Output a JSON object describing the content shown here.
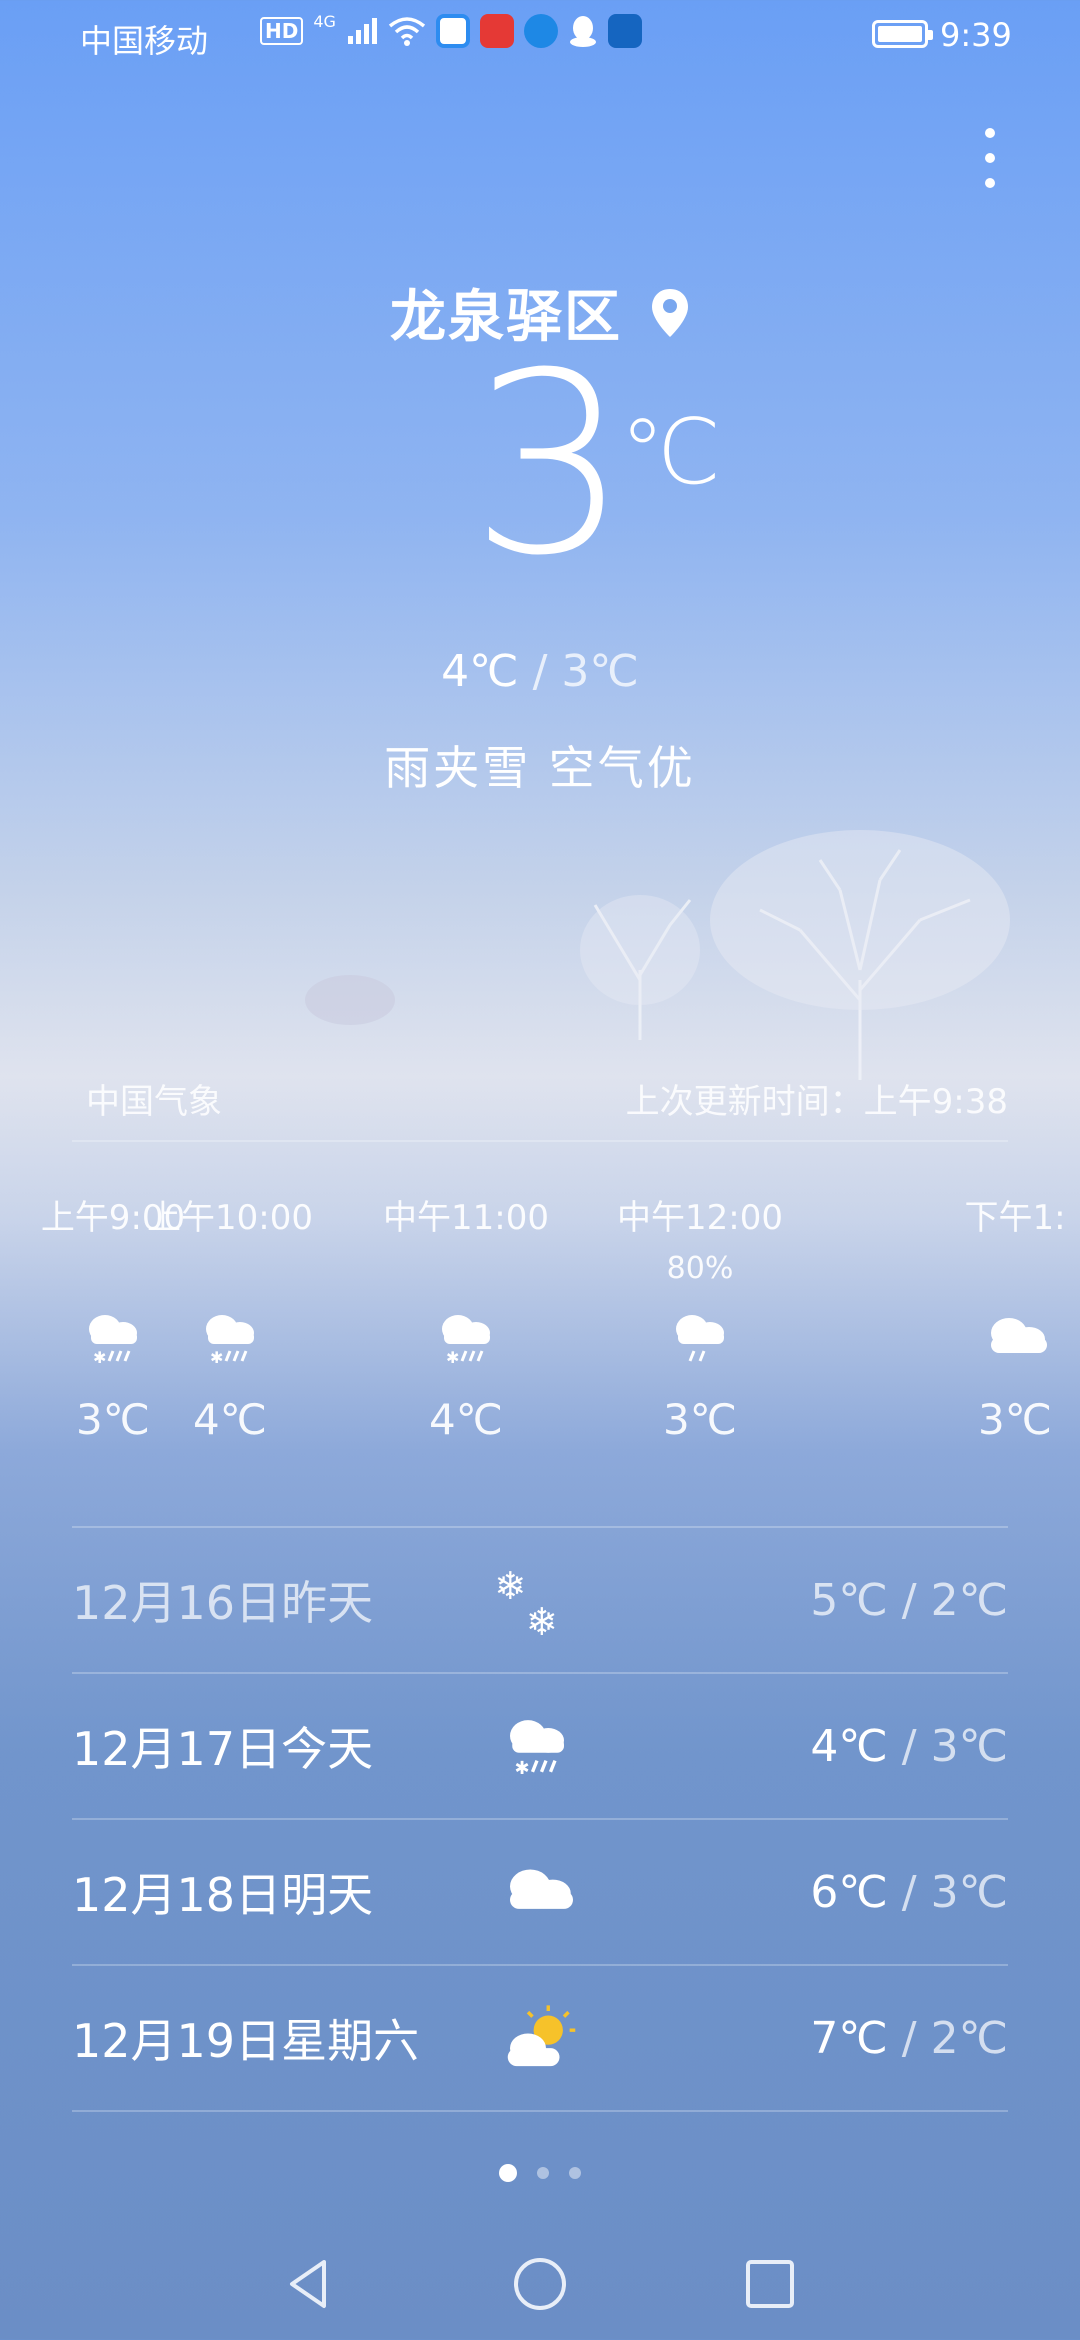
{
  "status_bar": {
    "carrier": "中国移动",
    "hd": "HD",
    "network": "4G",
    "time": "9:39",
    "battery_level": 1.0,
    "app_badge_colors": [
      "#2d8cf0",
      "#e53935",
      "#1e88e5",
      "#ffffff",
      "#1565c0"
    ]
  },
  "header": {
    "city": "龙泉驿区",
    "temperature": "3",
    "unit": "℃",
    "high": "4℃",
    "separator": " / ",
    "low": "3℃",
    "condition": "雨夹雪  空气优"
  },
  "meta": {
    "source": "中国气象",
    "updated": "上次更新时间：上午9:38"
  },
  "hourly": [
    {
      "time": "上午9:00",
      "pop": "",
      "temp": "3℃",
      "icon": "sleet-icon"
    },
    {
      "time": "上午10:00",
      "pop": "",
      "temp": "4℃",
      "icon": "sleet-icon"
    },
    {
      "time": "中午11:00",
      "pop": "",
      "temp": "4℃",
      "icon": "sleet-icon"
    },
    {
      "time": "中午12:00",
      "pop": "80%",
      "temp": "3℃",
      "icon": "rain-icon"
    },
    {
      "time": "下午1:",
      "pop": "",
      "temp": "3℃",
      "icon": "cloud-icon"
    }
  ],
  "daily": [
    {
      "date": "12月16日昨天",
      "high": "5℃",
      "low": "2℃",
      "icon": "snowflake-icon",
      "past": true
    },
    {
      "date": "12月17日今天",
      "high": "4℃",
      "low": "3℃",
      "icon": "sleet-icon",
      "past": false
    },
    {
      "date": "12月18日明天",
      "high": "6℃",
      "low": "3℃",
      "icon": "cloud-icon",
      "past": false
    },
    {
      "date": "12月19日星期六",
      "high": "7℃",
      "low": "2℃",
      "icon": "partly-sunny-icon",
      "past": false
    }
  ],
  "pager": {
    "pages": 3,
    "active": 0
  },
  "colors": {
    "sun": "#f6c22a"
  }
}
